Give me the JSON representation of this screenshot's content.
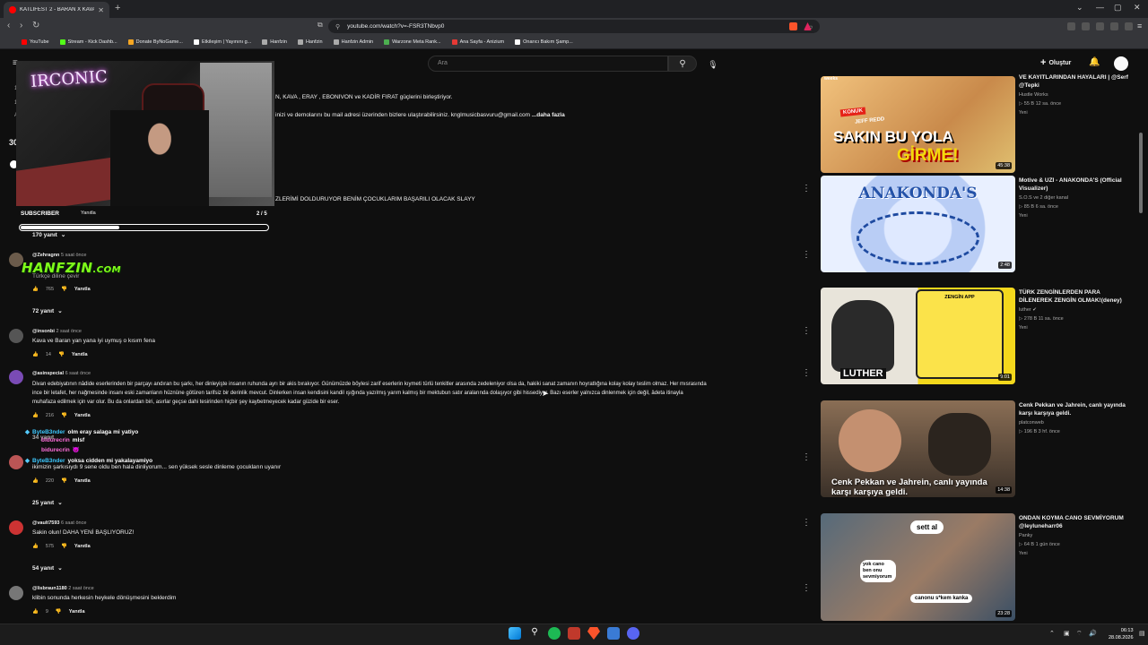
{
  "browser": {
    "tab_title": "KATLİFEST 2 - BARAN X KAVA X ...",
    "url": "youtube.com/watch?v=-FSR3TNbvp0",
    "bookmarks": [
      "YouTube",
      "Stream - Kick Dashb...",
      "Donate ByNoGame...",
      "Etkileşim | Yayınını g...",
      "Hanfzin",
      "Hanfzin",
      "Hanfzin Admin",
      "Warzone Meta Rank...",
      "Ana Sayfa - Anizium",
      "Onarıcı Bakım Şamp..."
    ]
  },
  "youtube": {
    "search_placeholder": "Ara",
    "create_label": "Oluştur"
  },
  "overlay": {
    "subscriber_label": "SUBSCRIBER",
    "subscriber_reply": "Yanıtla",
    "subscriber_count": "2 / 5",
    "subscriber_progress": 0.4,
    "watermark_main": "HANFZIN",
    "watermark_suffix": ".COM",
    "neon_sign": "IRCONIC"
  },
  "description": {
    "line1": "N, KAVA , ERAY , EBONIVON ve KADİR FIRAT güçlerini birleştiriyor.",
    "line2": "inizi ve demolarını bu mail adresi üzerinden bizlere ulaştırabilirsiniz. knglmusicbasvuru@gmail.com",
    "more": "...daha fazla",
    "line3": "ZLERİMİ DOLDURUYOR BENİM ÇOCUKLARIM BAŞARILI OLACAK SLAYY"
  },
  "comments": {
    "reply_label": "Yanıtla",
    "replies_top": "170 yanıt",
    "c1": {
      "user": "@Zehragnn",
      "time": "5 saat önce",
      "text": "Türkçe diline çevir",
      "likes": "765",
      "replies": "72 yanıt"
    },
    "c2": {
      "user": "@insonbi",
      "time": "2 saat önce",
      "text": "Kava ve Baran yan yana iyi uymuş o kısım fena",
      "likes": "14"
    },
    "c3": {
      "user": "@asinspecial",
      "time": "6 saat önce",
      "line1": "Divan edebiyatının nâdide eserlerinden bir parçayı andıran bu şarkı, her dinleyişte insanın ruhunda ayrı bir akis bırakıyor. Günümüzde böylesi zarif eserlerin kıymeti türlü tenkitler arasında zedeleniyor olsa da, hakiki sanat zamanın hoyratlığına kolay kolay teslim olmaz. Her mısrasında",
      "line2": "ince bir letafet, her nağmesinde insanı eski zamanların hüznüne götüren tarifsiz bir derinlik mevcut. Dinlerken insan kendisini kandil ışığında yazılmış yarım kalmış bir mektubun satır aralarında dolaşıyor gibi hissediyor. Bazı eserler yalnızca dinlenmek için değil, âdeta itinayla",
      "line3": "muhafaza edilmek için var olur. Bu da onlardan biri, asırlar geçse dahi tesirinden hiçbir şey kaybetmeyecek kadar güzide bir eser.",
      "likes": "216",
      "replies": "34 yanıt"
    },
    "c4": {
      "text": "ikimizin şarkısıydı 9 sene oldu ben hala dinliyorum... sen yüksek sesle dinleme çocukların uyanır",
      "likes": "220",
      "replies": "25 yanıt"
    },
    "c5": {
      "user": "@vault7593",
      "time": "6 saat önce",
      "text": "Sakin olun! DAHA YENİ BAŞLIYORUZ!",
      "likes": "575",
      "replies": "54 yanıt"
    },
    "c6": {
      "user": "@lisbraun1180",
      "time": "2 saat önce",
      "text": "klibin sonunda herkesin heykele dönüşmesini beklerdim",
      "likes": "9"
    }
  },
  "chat": {
    "m1_user": "ByteB3nder",
    "m1_text": "olm eray salaga mi yatiyo",
    "m2_user": "bidurecrin",
    "m2_text": "mlsf",
    "m3_user": "bidurecrin",
    "m3_text": "😈",
    "m4_user": "ByteB3nder",
    "m4_text": "yoksa cidden mi yakalayamiyo"
  },
  "sidebar": {
    "v1": {
      "title_top": "VE KAYITLARINDAN HAYALARI | @Serf",
      "title2": "@Tepki",
      "channel": "Hustle Works",
      "stats": "55 B  12 sa. önce",
      "badge": "Yeni",
      "duration": "45:38",
      "thumb_line1": "KONUK",
      "thumb_line2": "JEFF REDD",
      "thumb_line3": "SAKIN BU YOLA",
      "thumb_line4": "GİRME!",
      "thumb_top": "weeks"
    },
    "v2": {
      "title": "Motive & UZI - ANAKONDA'S (Official Visualizer)",
      "channel": "S.O.S ve 2 diğer kanal",
      "stats": "85 B  6 sa. önce",
      "badge": "Yeni",
      "duration": "2:48",
      "thumb_text": "ANAKONDA'S"
    },
    "v3": {
      "title": "TÜRK ZENGİNLERDEN PARA DİLENEREK ZENGİN OLMAK!(deney)",
      "channel": "luther",
      "stats": "278 B  11 sa. önce",
      "badge": "Yeni",
      "duration": "9:01",
      "thumb_app": "ZENGİN APP",
      "thumb_name": "LUTHER"
    },
    "v4": {
      "title": "Cenk Pekkan ve Jahrein, canlı yayında karşı karşıya geldi.",
      "channel": "platconweb",
      "stats": "196 B  3 hf. önce",
      "duration": "14:38",
      "thumb_text": "Cenk Pekkan ve Jahrein, canlı yayında karşı karşıya geldi."
    },
    "v5": {
      "title": "ONDAN KOYMA CANO SEVMİYORUM @leyluneharr06",
      "channel": "Panky",
      "stats": "64 B  1 gün önce",
      "badge": "Yeni",
      "duration": "23:28",
      "bubble1": "sett al",
      "bubble2": "yok cano ben onu sevmiyorum",
      "bubble3": "canonu s*kem kanka"
    }
  },
  "taskbar": {
    "time": "06:13",
    "date": "28.08.2026"
  }
}
